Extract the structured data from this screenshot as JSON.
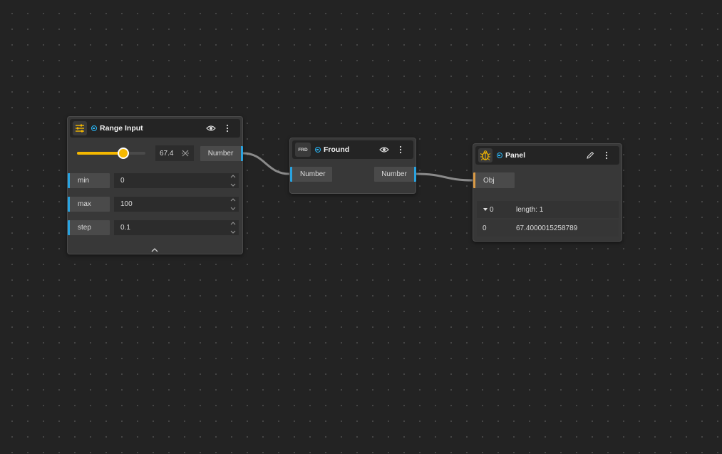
{
  "nodes": {
    "range_input": {
      "title": "Range Input",
      "icon": "sliders-icon",
      "slider_fraction": 0.674,
      "value": "67.4",
      "output_label": "Number",
      "params": [
        {
          "label": "min",
          "value": "0"
        },
        {
          "label": "max",
          "value": "100"
        },
        {
          "label": "step",
          "value": "0.1"
        }
      ]
    },
    "fround": {
      "title": "Fround",
      "icon_text": "FRD",
      "input_label": "Number",
      "output_label": "Number"
    },
    "panel": {
      "title": "Panel",
      "icon": "bug-icon",
      "input_label": "Obj",
      "rows": [
        {
          "key": "0",
          "value": "length: 1"
        },
        {
          "key": "0",
          "value": "67.4000015258789"
        }
      ]
    }
  },
  "colors": {
    "canvas_bg": "#232323",
    "node_bg": "#383838",
    "header_bg": "#242424",
    "port_number": "#29a3e0",
    "port_obj": "#d99a45",
    "slider_accent": "#f5b800",
    "status": "#29b6f6"
  }
}
